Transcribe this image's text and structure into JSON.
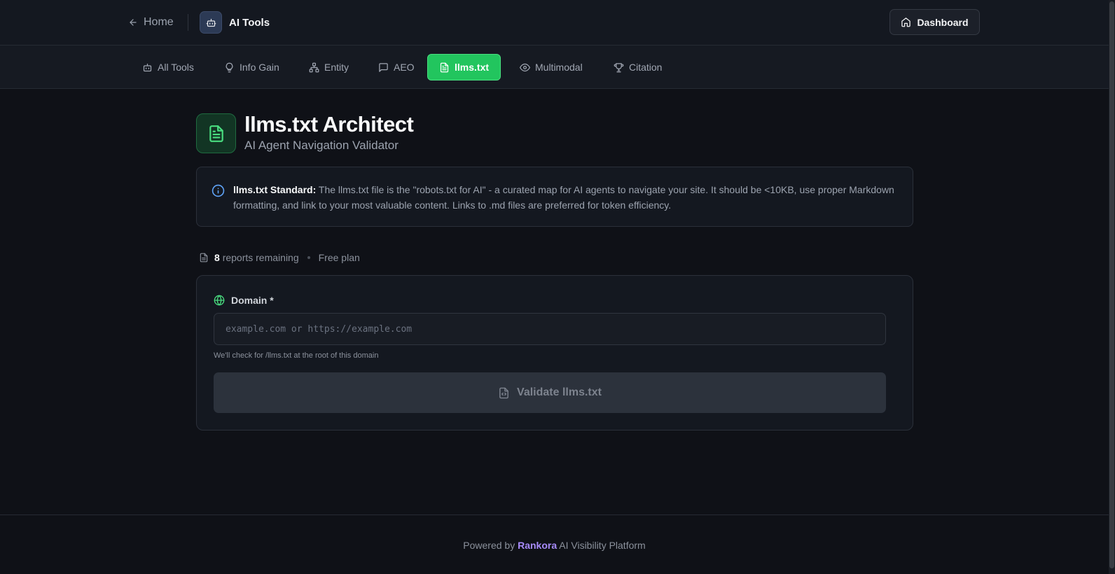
{
  "topbar": {
    "home_label": "Home",
    "brand_title": "AI Tools",
    "dashboard_label": "Dashboard"
  },
  "tabs": [
    {
      "label": "All Tools",
      "icon": "robot-icon",
      "active": false
    },
    {
      "label": "Info Gain",
      "icon": "lightbulb-icon",
      "active": false
    },
    {
      "label": "Entity",
      "icon": "network-icon",
      "active": false
    },
    {
      "label": "AEO",
      "icon": "message-icon",
      "active": false
    },
    {
      "label": "llms.txt",
      "icon": "file-text-icon",
      "active": true
    },
    {
      "label": "Multimodal",
      "icon": "eye-icon",
      "active": false
    },
    {
      "label": "Citation",
      "icon": "trophy-icon",
      "active": false
    }
  ],
  "header": {
    "title": "llms.txt Architect",
    "subtitle": "AI Agent Navigation Validator"
  },
  "info": {
    "label": "llms.txt Standard:",
    "text": " The llms.txt file is the \"robots.txt for AI\" - a curated map for AI agents to navigate your site. It should be <10KB, use proper Markdown formatting, and link to your most valuable content. Links to .md files are preferred for token efficiency."
  },
  "usage": {
    "count": "8",
    "remaining_text": "reports remaining",
    "plan": "Free plan"
  },
  "form": {
    "domain_label": "Domain *",
    "domain_placeholder": "example.com or https://example.com",
    "domain_value": "",
    "hint": "We'll check for /llms.txt at the root of this domain",
    "submit_label": "Validate llms.txt"
  },
  "footer": {
    "prefix": "Powered by ",
    "brand": "Rankora",
    "suffix": " AI Visibility Platform"
  },
  "colors": {
    "accent_green": "#22c55e",
    "brand_purple": "#a78bfa",
    "info_blue": "#60a5fa",
    "background": "#0f1117"
  }
}
